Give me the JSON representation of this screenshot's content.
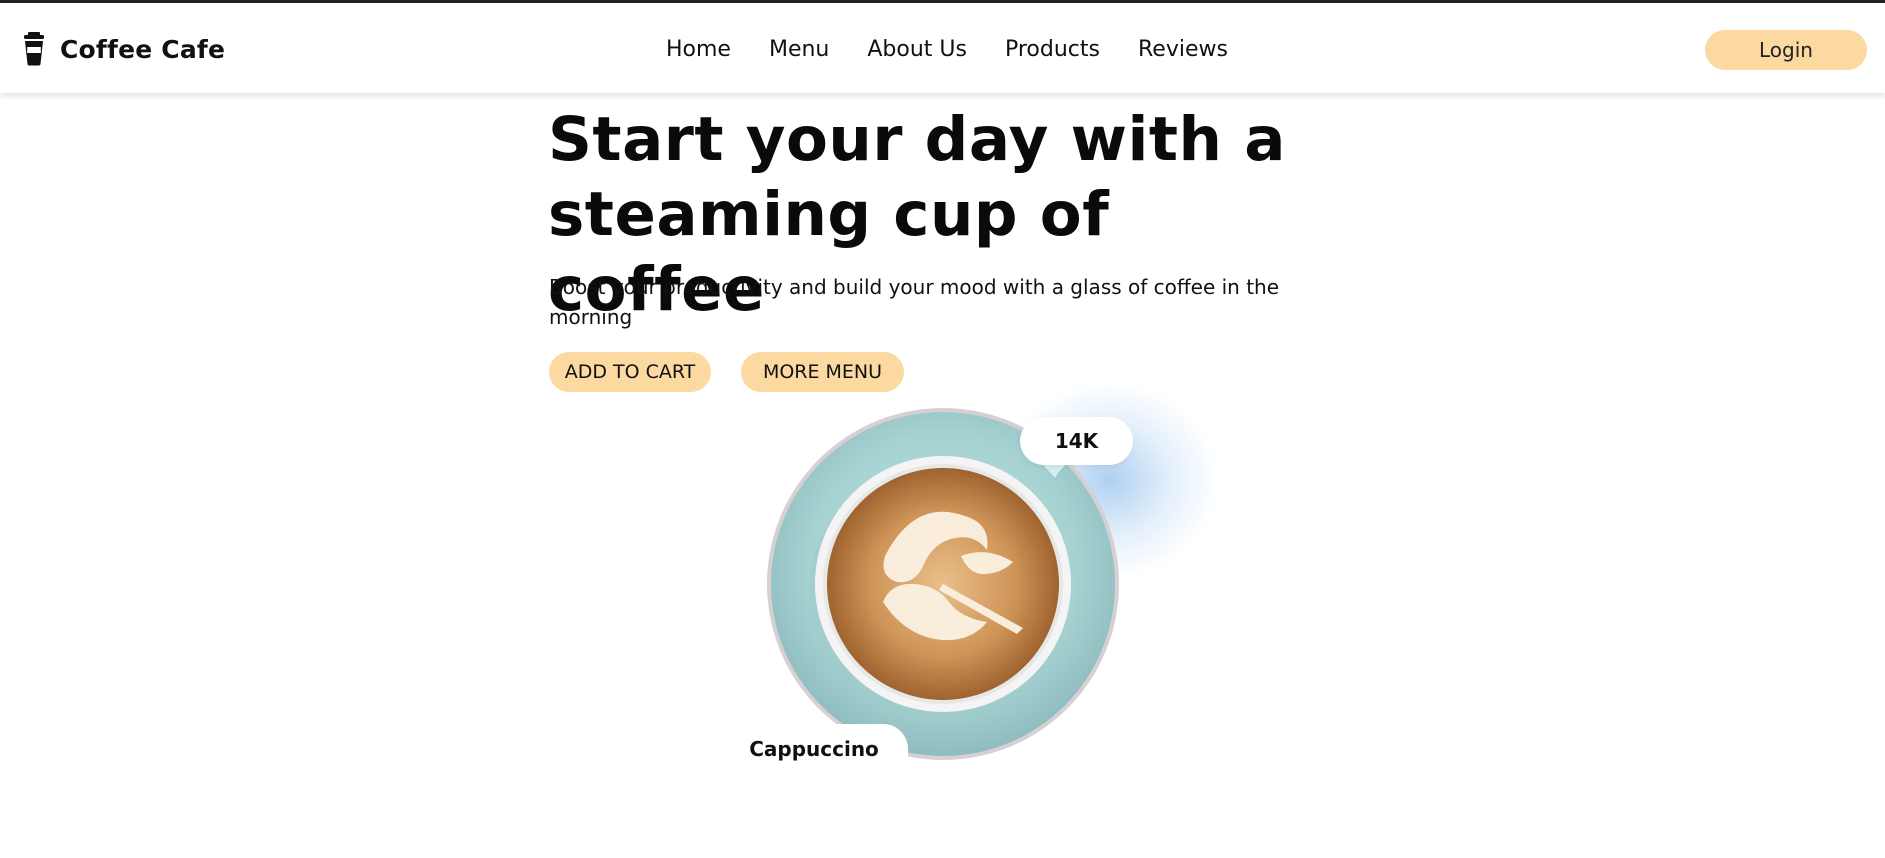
{
  "header": {
    "brand_name": "Coffee Cafe",
    "brand_icon": "coffee-cup-icon",
    "nav": [
      "Home",
      "Menu",
      "About Us",
      "Products",
      "Reviews"
    ],
    "login_label": "Login"
  },
  "hero": {
    "title_line1": "Start your day with a",
    "title_line2": "steaming cup of coffee",
    "subtitle": "Boost your productivity and build your mood with a glass of coffee in the morning",
    "add_to_cart_label": "ADD TO CART",
    "more_menu_label": "MORE MENU"
  },
  "product": {
    "likes": "14K",
    "name": "Cappuccino"
  },
  "colors": {
    "accent": "#fbd9a0",
    "saucer": "#a8d4d4",
    "coffee": "#c68a4e"
  }
}
